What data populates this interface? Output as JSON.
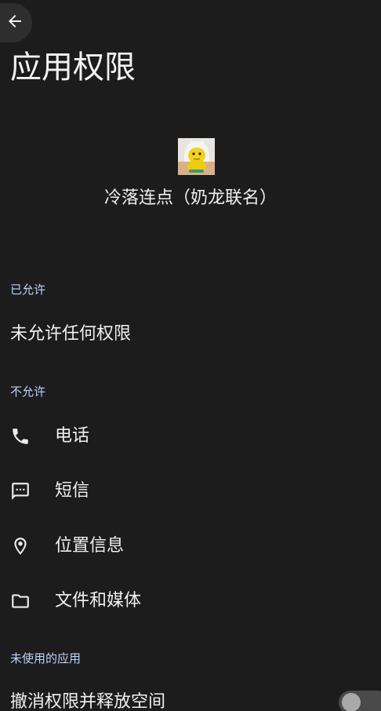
{
  "page": {
    "title": "应用权限"
  },
  "app": {
    "name": "冷落连点（奶龙联名）"
  },
  "allowed": {
    "header": "已允许",
    "empty_text": "未允许任何权限"
  },
  "denied": {
    "header": "不允许",
    "items": [
      {
        "label": "电话",
        "icon": "phone-icon"
      },
      {
        "label": "短信",
        "icon": "message-icon"
      },
      {
        "label": "位置信息",
        "icon": "location-icon"
      },
      {
        "label": "文件和媒体",
        "icon": "folder-icon"
      }
    ]
  },
  "unused": {
    "header": "未使用的应用",
    "revoke_label": "撤消权限并释放空间",
    "revoke_enabled": false
  },
  "colors": {
    "background": "#1c1c1c",
    "section_header": "#bcd3ff",
    "text": "#f0f0f0"
  }
}
